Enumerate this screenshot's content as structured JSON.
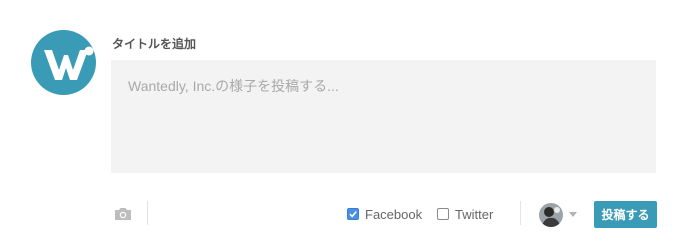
{
  "composer": {
    "title_link": "タイトルを追加",
    "body_placeholder": "Wantedly, Inc.の様子を投稿する...",
    "body_value": ""
  },
  "company_avatar": {
    "icon": "wantedly-w-logo",
    "color": "#3a9bb6"
  },
  "share": {
    "facebook": {
      "label": "Facebook",
      "checked": true
    },
    "twitter": {
      "label": "Twitter",
      "checked": false
    }
  },
  "footer": {
    "photo_icon": "camera-icon",
    "post_button_label": "投稿する",
    "accent_color": "#3a9bb6"
  }
}
